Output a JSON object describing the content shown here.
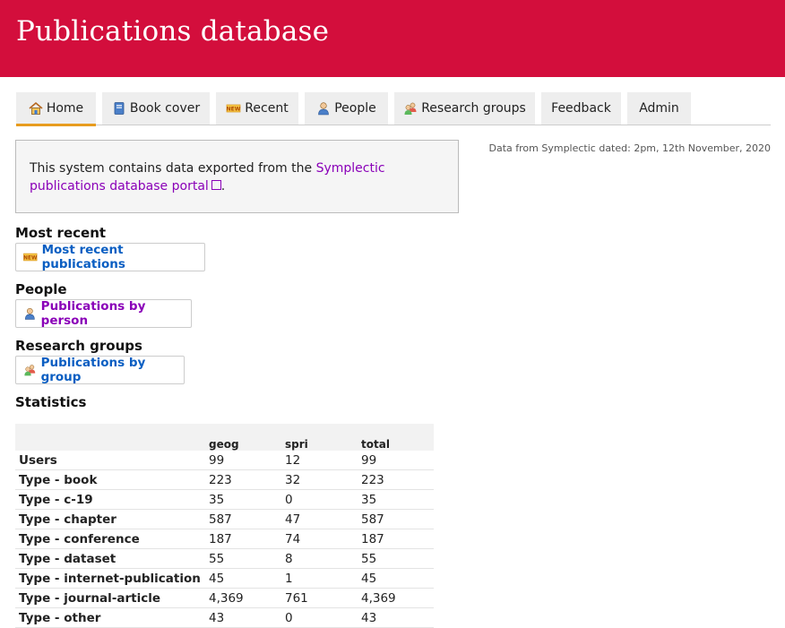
{
  "header": {
    "title": "Publications database"
  },
  "nav": {
    "tabs": [
      {
        "label": "Home",
        "icon": "home-icon"
      },
      {
        "label": "Book cover",
        "icon": "book-icon"
      },
      {
        "label": "Recent",
        "icon": "new-badge-icon"
      },
      {
        "label": "People",
        "icon": "person-icon"
      },
      {
        "label": "Research groups",
        "icon": "group-icon"
      },
      {
        "label": "Feedback"
      },
      {
        "label": "Admin"
      }
    ]
  },
  "data_note": "Data from Symplectic dated: 2pm, 12th November, 2020",
  "info": {
    "text_before": "This system contains data exported from the ",
    "link_text": "Symplectic publications database portal",
    "text_after": "."
  },
  "sections": {
    "recent": {
      "heading": "Most recent",
      "link": "Most recent publications"
    },
    "people": {
      "heading": "People",
      "link": "Publications by person"
    },
    "groups": {
      "heading": "Research groups",
      "link": "Publications by group"
    },
    "stats": {
      "heading": "Statistics"
    }
  },
  "stats_table": {
    "columns": [
      "",
      "geog",
      "spri",
      "total"
    ],
    "rows": [
      [
        "Users",
        "99",
        "12",
        "99"
      ],
      [
        "Type - book",
        "223",
        "32",
        "223"
      ],
      [
        "Type - c-19",
        "35",
        "0",
        "35"
      ],
      [
        "Type - chapter",
        "587",
        "47",
        "587"
      ],
      [
        "Type - conference",
        "187",
        "74",
        "187"
      ],
      [
        "Type - dataset",
        "55",
        "8",
        "55"
      ],
      [
        "Type - internet-publication",
        "45",
        "1",
        "45"
      ],
      [
        "Type - journal-article",
        "4,369",
        "761",
        "4,369"
      ],
      [
        "Type - other",
        "43",
        "0",
        "43"
      ]
    ]
  },
  "colors": {
    "banner": "#d30e3c",
    "active_tab_underline": "#e79c1e",
    "link_blue": "#0a5ec2",
    "link_purple": "#8a00b8"
  }
}
